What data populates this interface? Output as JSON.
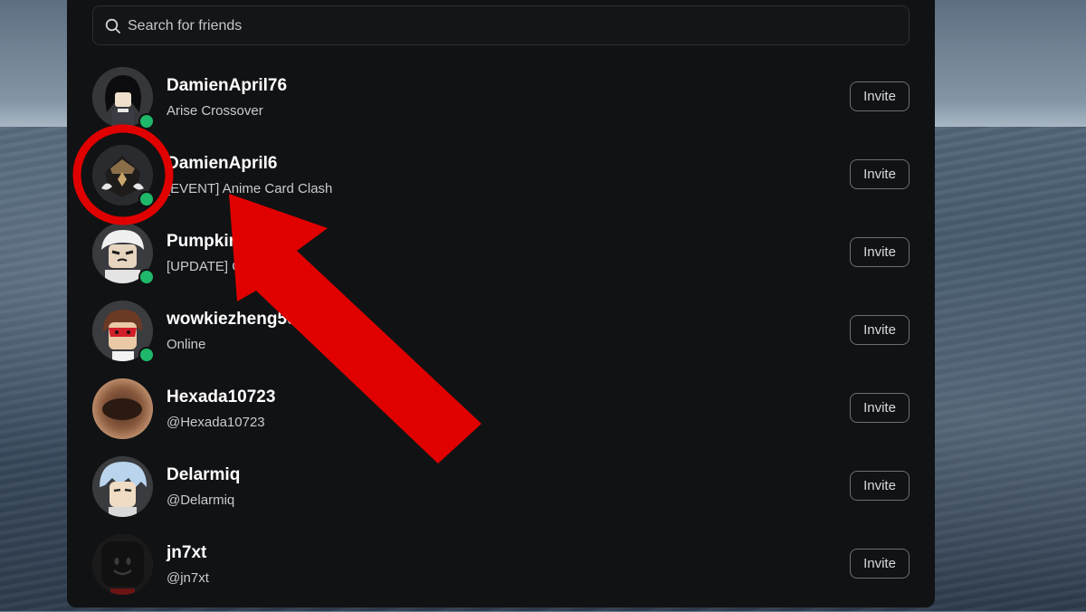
{
  "search": {
    "placeholder": "Search for friends"
  },
  "friends": [
    {
      "name": "DamienApril76",
      "status": "Arise Crossover",
      "online": true,
      "invite_label": "Invite"
    },
    {
      "name": "DamienApril6",
      "status": "[EVENT] Anime Card Clash",
      "online": true,
      "invite_label": "Invite"
    },
    {
      "name": "Pumpkin",
      "status": "[UPDATE] Gra",
      "online": true,
      "invite_label": "Invite"
    },
    {
      "name": "wowkiezheng56",
      "status": "Online",
      "online": true,
      "invite_label": "Invite"
    },
    {
      "name": "Hexada10723",
      "status": "@Hexada10723",
      "online": false,
      "invite_label": "Invite"
    },
    {
      "name": "Delarmiq",
      "status": "@Delarmiq",
      "online": false,
      "invite_label": "Invite"
    },
    {
      "name": "jn7xt",
      "status": "@jn7xt",
      "online": false,
      "invite_label": "Invite"
    }
  ],
  "colors": {
    "online": "#1fb86a",
    "highlight": "#e00000",
    "panel": "#111214"
  },
  "annotation": {
    "type": "red-circle-and-arrow",
    "target": "DamienApril6 avatar"
  }
}
